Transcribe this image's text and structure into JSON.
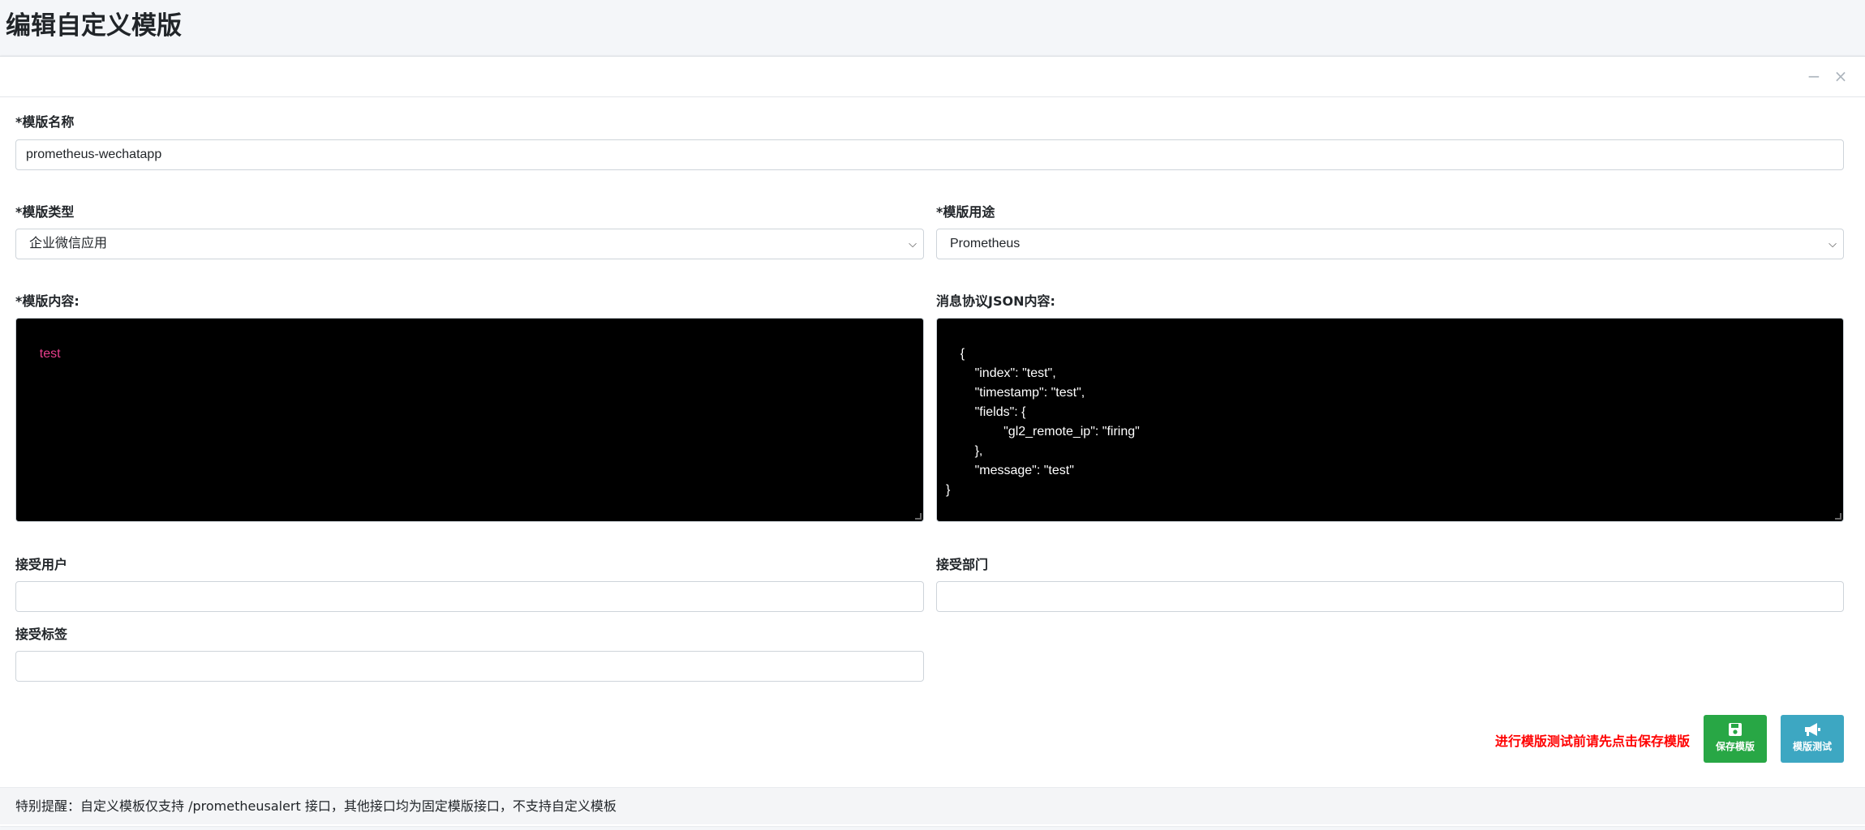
{
  "page": {
    "title": "编辑自定义模版"
  },
  "card": {
    "minimize_glyph": "−",
    "close_glyph": "×"
  },
  "form": {
    "name_label": "*模版名称",
    "name_value": "prometheus-wechatapp",
    "type_label": "*模版类型",
    "type_value": "企业微信应用",
    "usage_label": "*模版用途",
    "usage_value": "Prometheus",
    "content_label": "*模版内容:",
    "content_value": "test",
    "json_label": "消息协议JSON内容:",
    "json_value": "{\n        \"index\": \"test\",\n        \"timestamp\": \"test\",\n        \"fields\": {\n                \"gl2_remote_ip\": \"firing\"\n        },\n        \"message\": \"test\"\n}",
    "users_label": "接受用户",
    "users_value": "",
    "dept_label": "接受部门",
    "dept_value": "",
    "tags_label": "接受标签",
    "tags_value": ""
  },
  "actions": {
    "warning": "进行模版测试前请先点击保存模版",
    "save_label": "保存模版",
    "test_label": "模版测试",
    "save_icon": "floppy-disk-icon",
    "test_icon": "megaphone-icon"
  },
  "footer": {
    "note": "特别提醒：自定义模板仅支持 /prometheusalert 接口，其他接口均为固定模版接口，不支持自定义模板"
  },
  "colors": {
    "save_button": "#28a745",
    "test_button": "#3da7c2",
    "warning_text": "#ff0000",
    "editor_bg": "#000000",
    "content_text": "#e83e8c"
  }
}
